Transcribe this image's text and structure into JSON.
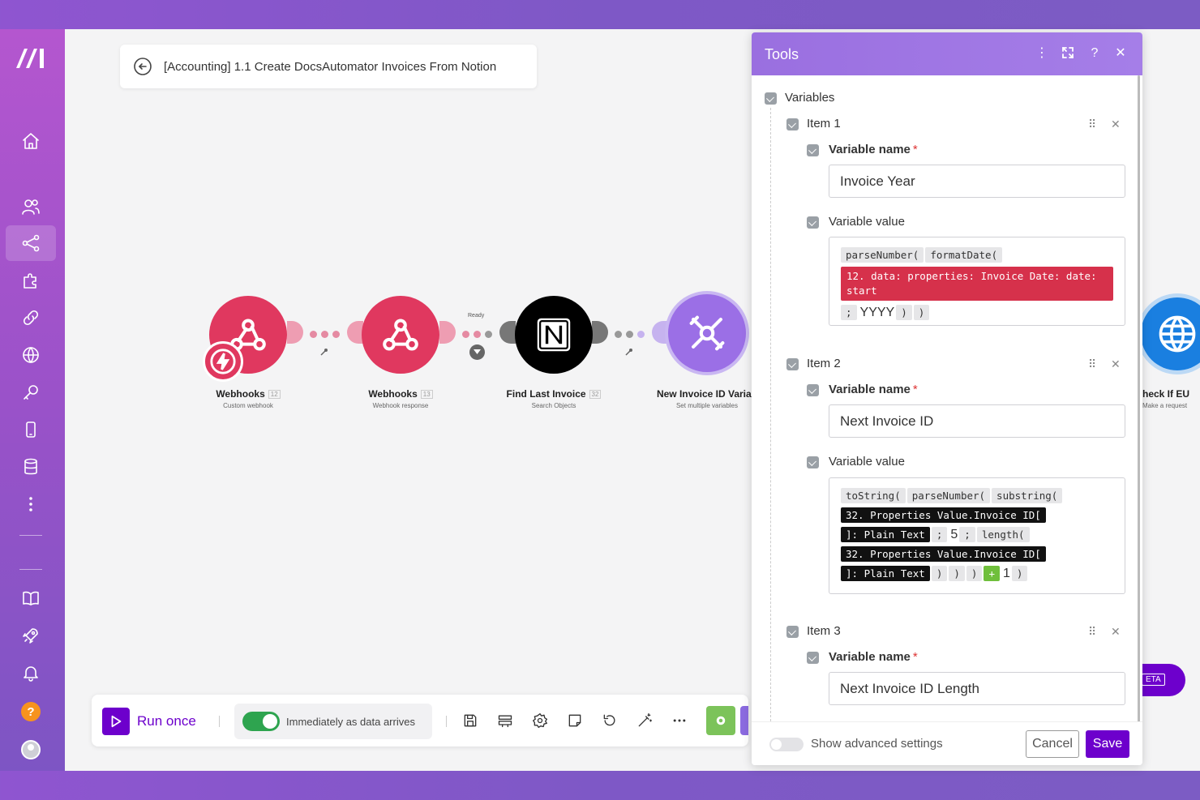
{
  "scenario": {
    "title": "[Accounting] 1.1 Create DocsAutomator Invoices From Notion"
  },
  "modules": [
    {
      "name": "Webhooks",
      "num": "12",
      "sub": "Custom webhook",
      "color": "#e0385f"
    },
    {
      "name": "Webhooks",
      "num": "13",
      "sub": "Webhook response",
      "color": "#e0385f"
    },
    {
      "name": "Find Last Invoice",
      "num": "32",
      "sub": "Search Objects",
      "color": "#000000"
    },
    {
      "name": "New Invoice ID Variab",
      "num": "",
      "sub": "Set multiple variables",
      "color": "#9b6fe6"
    },
    {
      "name": "heck If EU",
      "num": "",
      "sub": "Make a request",
      "color": "#1a7fe0"
    }
  ],
  "connector_status": "Ready",
  "toolbar": {
    "run_label": "Run once",
    "schedule_label": "Immediately as data arrives"
  },
  "beta_label": "ETA",
  "panel": {
    "title": "Tools",
    "section_label": "Variables",
    "items": [
      {
        "label": "Item 1",
        "name_label": "Variable name",
        "name_value": "Invoice Year",
        "value_label": "Variable value"
      },
      {
        "label": "Item 2",
        "name_label": "Variable name",
        "name_value": "Next Invoice ID",
        "value_label": "Variable value"
      },
      {
        "label": "Item 3",
        "name_label": "Variable name",
        "name_value": "Next Invoice ID Length"
      }
    ],
    "value1": {
      "fn1": "parseNumber(",
      "fn2": "formatDate(",
      "ref": "12. data: properties: Invoice Date: date: start",
      "sep": ";",
      "text": "YYYY",
      "close1": ")",
      "close2": ")"
    },
    "value2": {
      "fn1": "toString(",
      "fn2": "parseNumber(",
      "fn3": "substring(",
      "ref1a": "32. Properties Value.Invoice ID[",
      "ref1b": "]: Plain Text",
      "sep1": ";",
      "num": "5",
      "sep2": ";",
      "fn4": "length(",
      "ref2a": "32. Properties Value.Invoice ID[",
      "ref2b": "]: Plain Text",
      "close1": ")",
      "close2": ")",
      "close3": ")",
      "plus": "+",
      "one": "1",
      "close4": ")"
    },
    "footer": {
      "advanced_label": "Show advanced settings",
      "cancel_label": "Cancel",
      "save_label": "Save"
    }
  }
}
